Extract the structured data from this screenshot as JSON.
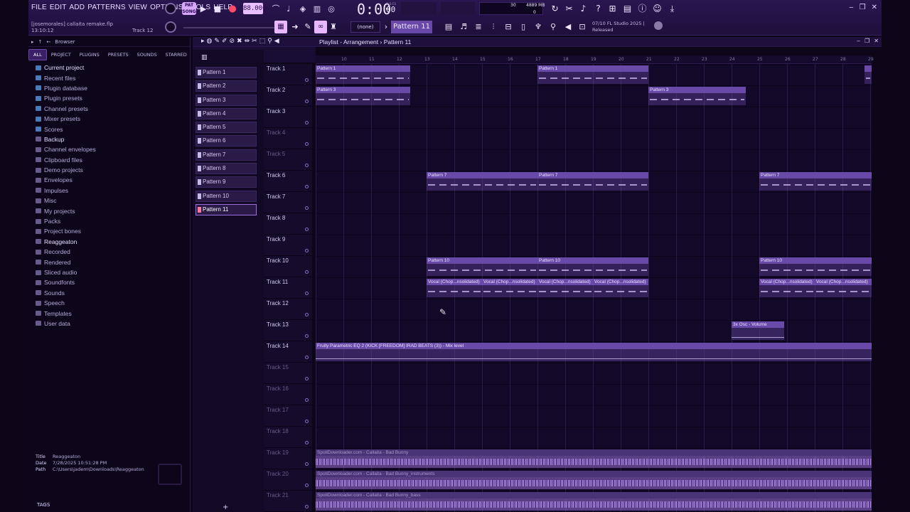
{
  "menu": [
    "FILE",
    "EDIT",
    "ADD",
    "PATTERNS",
    "VIEW",
    "OPTIONS",
    "TOOLS",
    "HELP"
  ],
  "project": {
    "user_file": "[josemorales] callaita remake.flp",
    "time": "13:10:12",
    "track_hint": "Track 12"
  },
  "transport": {
    "pat_label": "PAT",
    "song_label": "SONG",
    "tempo": "88.000",
    "clock": "0:00",
    "clock_ms": "00",
    "clock_tag": "M:S:CS"
  },
  "monitor": {
    "cpu": "30",
    "memory": "4889 MB",
    "polyphony": "0"
  },
  "toolbar2": {
    "snap_none": "(none)",
    "pattern": "Pattern 11"
  },
  "news": {
    "count": "07/10",
    "line1": "FL Studio 2025 |",
    "line2": "Released"
  },
  "browser": {
    "title": "Browser",
    "tabs": [
      "ALL",
      "PROJECT",
      "PLUGINS",
      "PRESETS",
      "SOUNDS",
      "STARRED"
    ],
    "items": [
      {
        "label": "Current project",
        "bold": true,
        "icon": "plug"
      },
      {
        "label": "Recent files",
        "bold": false,
        "icon": "plug"
      },
      {
        "label": "Plugin database",
        "bold": false,
        "icon": "plug"
      },
      {
        "label": "Plugin presets",
        "bold": false,
        "icon": "plug"
      },
      {
        "label": "Channel presets",
        "bold": false,
        "icon": "plug"
      },
      {
        "label": "Mixer presets",
        "bold": false,
        "icon": "plug"
      },
      {
        "label": "Scores",
        "bold": false,
        "icon": "plug"
      },
      {
        "label": "Backup",
        "bold": true,
        "icon": "folder"
      },
      {
        "label": "Channel envelopes",
        "bold": false,
        "icon": "folder"
      },
      {
        "label": "Clipboard files",
        "bold": false,
        "icon": "folder"
      },
      {
        "label": "Demo projects",
        "bold": false,
        "icon": "folder"
      },
      {
        "label": "Envelopes",
        "bold": false,
        "icon": "folder"
      },
      {
        "label": "Impulses",
        "bold": false,
        "icon": "folder"
      },
      {
        "label": "Misc",
        "bold": false,
        "icon": "folder"
      },
      {
        "label": "My projects",
        "bold": false,
        "icon": "folder"
      },
      {
        "label": "Packs",
        "bold": false,
        "icon": "folder"
      },
      {
        "label": "Project bones",
        "bold": false,
        "icon": "folder"
      },
      {
        "label": "Reaggeaton",
        "bold": true,
        "icon": "folder"
      },
      {
        "label": "Recorded",
        "bold": false,
        "icon": "folder"
      },
      {
        "label": "Rendered",
        "bold": false,
        "icon": "folder"
      },
      {
        "label": "Sliced audio",
        "bold": false,
        "icon": "folder"
      },
      {
        "label": "Soundfonts",
        "bold": false,
        "icon": "folder"
      },
      {
        "label": "Sounds",
        "bold": false,
        "icon": "folder"
      },
      {
        "label": "Speech",
        "bold": false,
        "icon": "folder"
      },
      {
        "label": "Templates",
        "bold": false,
        "icon": "folder"
      },
      {
        "label": "User data",
        "bold": false,
        "icon": "user"
      }
    ],
    "info": {
      "title_key": "Title",
      "title_val": "Reaggeaton",
      "date_key": "Date",
      "date_val": "7/28/2025 10:51:28 PM",
      "path_key": "Path",
      "path_val": "C:\\Users\\jadem\\Downloads\\Reaggeaton"
    },
    "tags_label": "TAGS"
  },
  "patterns": [
    "Pattern 1",
    "Pattern 2",
    "Pattern 3",
    "Pattern 4",
    "Pattern 5",
    "Pattern 6",
    "Pattern 7",
    "Pattern 8",
    "Pattern 9",
    "Pattern 10",
    "Pattern 11"
  ],
  "selected_pattern_index": 10,
  "playlist": {
    "title": "Playlist - Arrangement",
    "sep": "›",
    "pattern": "Pattern 11",
    "bars": [
      "10",
      "11",
      "12",
      "13",
      "14",
      "15",
      "16",
      "17",
      "18",
      "19",
      "20",
      "21",
      "22",
      "23",
      "24",
      "25",
      "26",
      "27",
      "28",
      "29"
    ],
    "tracks": [
      {
        "name": "Track 1",
        "dim": false
      },
      {
        "name": "Track 2",
        "dim": false
      },
      {
        "name": "Track 3",
        "dim": false
      },
      {
        "name": "Track 4",
        "dim": true
      },
      {
        "name": "Track 5",
        "dim": true
      },
      {
        "name": "Track 6",
        "dim": false
      },
      {
        "name": "Track 7",
        "dim": false
      },
      {
        "name": "Track 8",
        "dim": false
      },
      {
        "name": "Track 9",
        "dim": false
      },
      {
        "name": "Track 10",
        "dim": false
      },
      {
        "name": "Track 11",
        "dim": false
      },
      {
        "name": "Track 12",
        "dim": false
      },
      {
        "name": "Track 13",
        "dim": false
      },
      {
        "name": "Track 14",
        "dim": false
      },
      {
        "name": "Track 15",
        "dim": true
      },
      {
        "name": "Track 16",
        "dim": true
      },
      {
        "name": "Track 17",
        "dim": true
      },
      {
        "name": "Track 18",
        "dim": true
      },
      {
        "name": "Track 19",
        "dim": true
      },
      {
        "name": "Track 20",
        "dim": true
      },
      {
        "name": "Track 21",
        "dim": true
      }
    ],
    "clips": [
      {
        "track": 0,
        "start": 10,
        "end": 13.4,
        "label": "Pattern 1",
        "kind": "pattern"
      },
      {
        "track": 0,
        "start": 18,
        "end": 22,
        "label": "Pattern 1",
        "kind": "pattern"
      },
      {
        "track": 0,
        "start": 29.8,
        "end": 30.1,
        "label": "",
        "kind": "pattern"
      },
      {
        "track": 1,
        "start": 10,
        "end": 13.4,
        "label": "Pattern 3",
        "kind": "pattern"
      },
      {
        "track": 1,
        "start": 22,
        "end": 25.5,
        "label": "Pattern 3",
        "kind": "pattern"
      },
      {
        "track": 5,
        "start": 14,
        "end": 18,
        "label": "Pattern 7",
        "kind": "pattern"
      },
      {
        "track": 5,
        "start": 18,
        "end": 22,
        "label": "Pattern 7",
        "kind": "pattern"
      },
      {
        "track": 5,
        "start": 26,
        "end": 30.1,
        "label": "Pattern 7",
        "kind": "pattern"
      },
      {
        "track": 9,
        "start": 14,
        "end": 18,
        "label": "Pattern 10",
        "kind": "pattern"
      },
      {
        "track": 9,
        "start": 18,
        "end": 22,
        "label": "Pattern 10",
        "kind": "pattern"
      },
      {
        "track": 9,
        "start": 26,
        "end": 30.1,
        "label": "Pattern 10",
        "kind": "pattern"
      },
      {
        "track": 10,
        "start": 14,
        "end": 16,
        "label": "Vocal (Chop...nsolidated)",
        "kind": "pattern"
      },
      {
        "track": 10,
        "start": 16,
        "end": 18,
        "label": "Vocal (Chop...nsolidated)",
        "kind": "pattern"
      },
      {
        "track": 10,
        "start": 18,
        "end": 20,
        "label": "Vocal (Chop...nsolidated)",
        "kind": "pattern"
      },
      {
        "track": 10,
        "start": 20,
        "end": 22,
        "label": "Vocal (Chop...nsolidated)",
        "kind": "pattern"
      },
      {
        "track": 10,
        "start": 26,
        "end": 28,
        "label": "Vocal (Chop...nsolidated)",
        "kind": "pattern"
      },
      {
        "track": 10,
        "start": 28,
        "end": 30.1,
        "label": "Vocal (Chop...nsolidated)",
        "kind": "pattern"
      },
      {
        "track": 12,
        "start": 25.0,
        "end": 26.9,
        "label": "3x Osc - Volume",
        "kind": "auto"
      },
      {
        "track": 13,
        "start": 10,
        "end": 30.1,
        "label": "Fruity Parametric EQ 2 (KICK [FREEDOM] IRAD BEATS (3)) - Mix level",
        "kind": "auto"
      },
      {
        "track": 18,
        "start": 10,
        "end": 30.1,
        "label": "SpotiDownloader.com - Callaita - Bad Bunny",
        "kind": "audio"
      },
      {
        "track": 19,
        "start": 10,
        "end": 30.1,
        "label": "SpotiDownloader.com - Callaita - Bad Bunny_instruments",
        "kind": "audio"
      },
      {
        "track": 20,
        "start": 10,
        "end": 30.1,
        "label": "SpotiDownloader.com - Callaita - Bad Bunny_bass",
        "kind": "audio"
      }
    ]
  },
  "colors": {
    "accent": "#e8b8ff",
    "bg": "#0c0618",
    "clip": "#6a4aa8"
  }
}
